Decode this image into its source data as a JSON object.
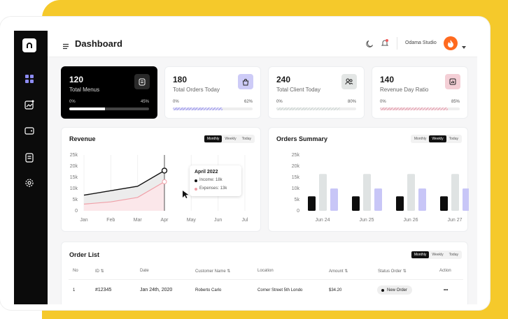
{
  "topbar": {
    "title": "Dashboard",
    "user": "Odama Studio"
  },
  "stats": [
    {
      "value": "120",
      "label": "Total Menus",
      "left": "0%",
      "right": "45%",
      "progress": 0.45,
      "dark": true
    },
    {
      "value": "180",
      "label": "Total Orders Today",
      "left": "0%",
      "right": "62%",
      "progress": 0.62,
      "color": "#b3b0f0"
    },
    {
      "value": "240",
      "label": "Total Client Today",
      "left": "0%",
      "right": "80%",
      "progress": 0.8,
      "color": "#d6dcda"
    },
    {
      "value": "140",
      "label": "Revenue Day Ratio",
      "left": "0%",
      "right": "85%",
      "progress": 0.85,
      "color": "#eab4c0"
    }
  ],
  "revenue": {
    "title": "Revenue",
    "tabs": [
      "Monthly",
      "Weekly",
      "Today"
    ],
    "active_tab": "Monthly",
    "tooltip": {
      "title": "April 2022",
      "income": "Income: 18k",
      "expenses": "Expenses: 13k"
    }
  },
  "orders_summary": {
    "title": "Orders Summary",
    "tabs": [
      "Monthly",
      "Weekly",
      "Today"
    ],
    "active_tab": "Weekly"
  },
  "order_list": {
    "title": "Order List",
    "tabs": [
      "Monthly",
      "Weekly",
      "Today"
    ],
    "active_tab": "Monthly",
    "headers": [
      "No",
      "ID",
      "Date",
      "Customer Name",
      "Location",
      "Amount",
      "Status Order",
      "Action"
    ],
    "row": {
      "no": "1",
      "id": "#12345",
      "date": "Jan 24th, 2020",
      "customer": "Roberto Carlo",
      "location": "Corner Street 5th Londo",
      "amount": "$34.20",
      "status": "New Order",
      "action": "•••"
    }
  },
  "chart_data": [
    {
      "type": "line",
      "title": "Revenue",
      "x": [
        "Jan",
        "Feb",
        "Mar",
        "Apr",
        "May",
        "Jun",
        "Jul"
      ],
      "yticks": [
        "25k",
        "20k",
        "15k",
        "10k",
        "5k",
        "0"
      ],
      "ylim": [
        0,
        25
      ],
      "series": [
        {
          "name": "Income",
          "values": [
            7,
            9,
            11,
            18
          ],
          "color": "#111111"
        },
        {
          "name": "Expenses",
          "values": [
            3,
            4,
            6,
            13
          ],
          "color": "#f0a0a8"
        }
      ]
    },
    {
      "type": "bar",
      "title": "Orders Summary",
      "categories": [
        "Jun 24",
        "Jun 25",
        "Jun 26",
        "Jun 27"
      ],
      "yticks": [
        "25k",
        "20k",
        "15k",
        "10k",
        "5k",
        "0"
      ],
      "ylim": [
        0,
        25
      ],
      "series": [
        {
          "values": [
            6.5,
            6.5,
            6.5,
            6.5
          ],
          "color": "#0d0d0d"
        },
        {
          "values": [
            16.5,
            16.5,
            16.5,
            16.5
          ],
          "color": "#dfe3e3"
        },
        {
          "values": [
            10,
            10,
            10,
            10
          ],
          "color": "#c8c6f7"
        }
      ]
    }
  ]
}
